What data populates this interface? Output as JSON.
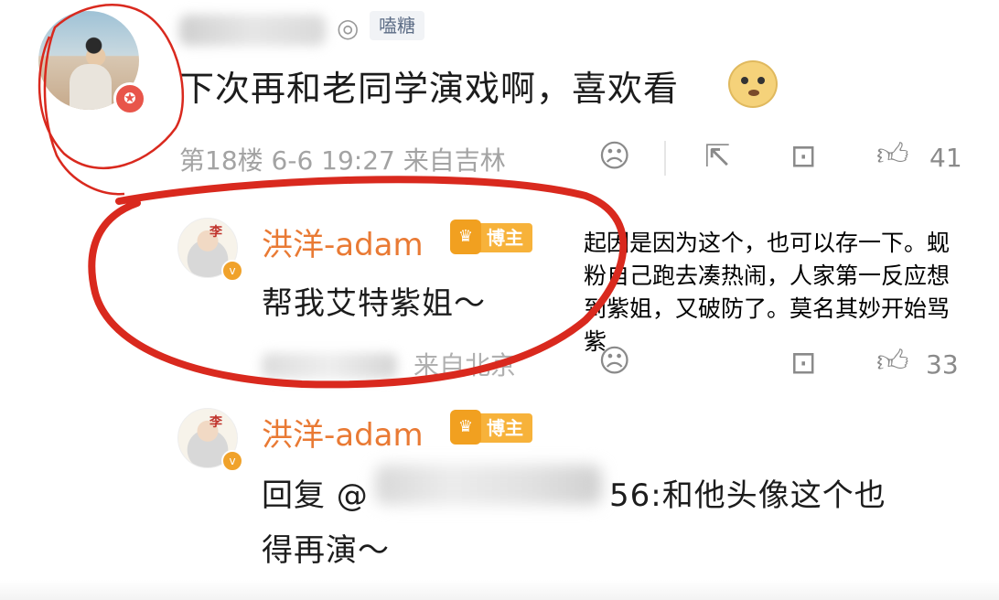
{
  "top_comment": {
    "tag": "嗑糖",
    "text": "下次再和老同学演戏啊，喜欢看",
    "meta": "第18楼 6-6 19:27 来自吉林",
    "like_count": "41"
  },
  "replies": [
    {
      "avatar_text": "李\n王\n身",
      "name": "洪洋-adam",
      "badge": "博主",
      "text": "帮我艾特紫姐～",
      "meta": "来自北京",
      "like_count": "33"
    },
    {
      "avatar_text": "李\n王\n身",
      "name": "洪洋-adam",
      "badge": "博主",
      "text_line1": "回复 @",
      "text_line1_suffix": "56:和他头像这个也",
      "text_line2": "得再演～"
    }
  ],
  "annotation": "起因是因为这个，也可以存一下。蚬粉自己跑去凑热闹，人家第一反应想到紫姐，又破防了。莫名其妙开始骂紫",
  "icons": {
    "tag": "lollipop-icon",
    "emoji": "doge-emoji",
    "dislike": "frown-face-icon",
    "share": "share-icon",
    "comment": "comment-icon",
    "like": "thumbs-up-icon",
    "badge": "crown-badge-icon"
  },
  "colors": {
    "name_orange": "#e97a34",
    "badge_gold": "#f7b23a",
    "annotation_red": "#d9291e"
  }
}
